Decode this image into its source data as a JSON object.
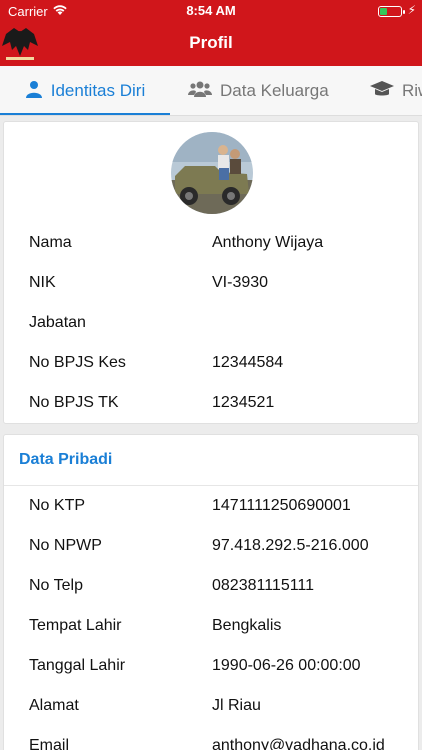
{
  "status_bar": {
    "carrier": "Carrier",
    "time": "8:54 AM",
    "battery_level": 0.3,
    "battery_color": "#34c759"
  },
  "nav": {
    "title": "Profil",
    "logo_icon": "eagle-logo-icon",
    "background": "#d0161b"
  },
  "tabs": [
    {
      "label": "Identitas Diri",
      "icon": "person-icon",
      "active": true
    },
    {
      "label": "Data Keluarga",
      "icon": "people-icon",
      "active": false
    },
    {
      "label": "Riw",
      "icon": "graduation-cap-icon",
      "active": false
    }
  ],
  "accent_color": "#1a7fd6",
  "identity": {
    "rows": [
      {
        "label": "Nama",
        "value": "Anthony Wijaya"
      },
      {
        "label": "NIK",
        "value": "VI-3930"
      },
      {
        "label": "Jabatan",
        "value": ""
      },
      {
        "label": "No BPJS Kes",
        "value": "12344584"
      },
      {
        "label": "No BPJS TK",
        "value": "1234521"
      }
    ]
  },
  "personal": {
    "title": "Data Pribadi",
    "rows": [
      {
        "label": "No KTP",
        "value": "1471111250690001"
      },
      {
        "label": "No NPWP",
        "value": "97.418.292.5-216.000"
      },
      {
        "label": "No Telp",
        "value": "082381115111"
      },
      {
        "label": "Tempat Lahir",
        "value": "Bengkalis"
      },
      {
        "label": "Tanggal Lahir",
        "value": "1990-06-26 00:00:00"
      },
      {
        "label": "Alamat",
        "value": "Jl Riau"
      },
      {
        "label": "Email",
        "value": "anthony@vadhana.co.id"
      }
    ]
  }
}
